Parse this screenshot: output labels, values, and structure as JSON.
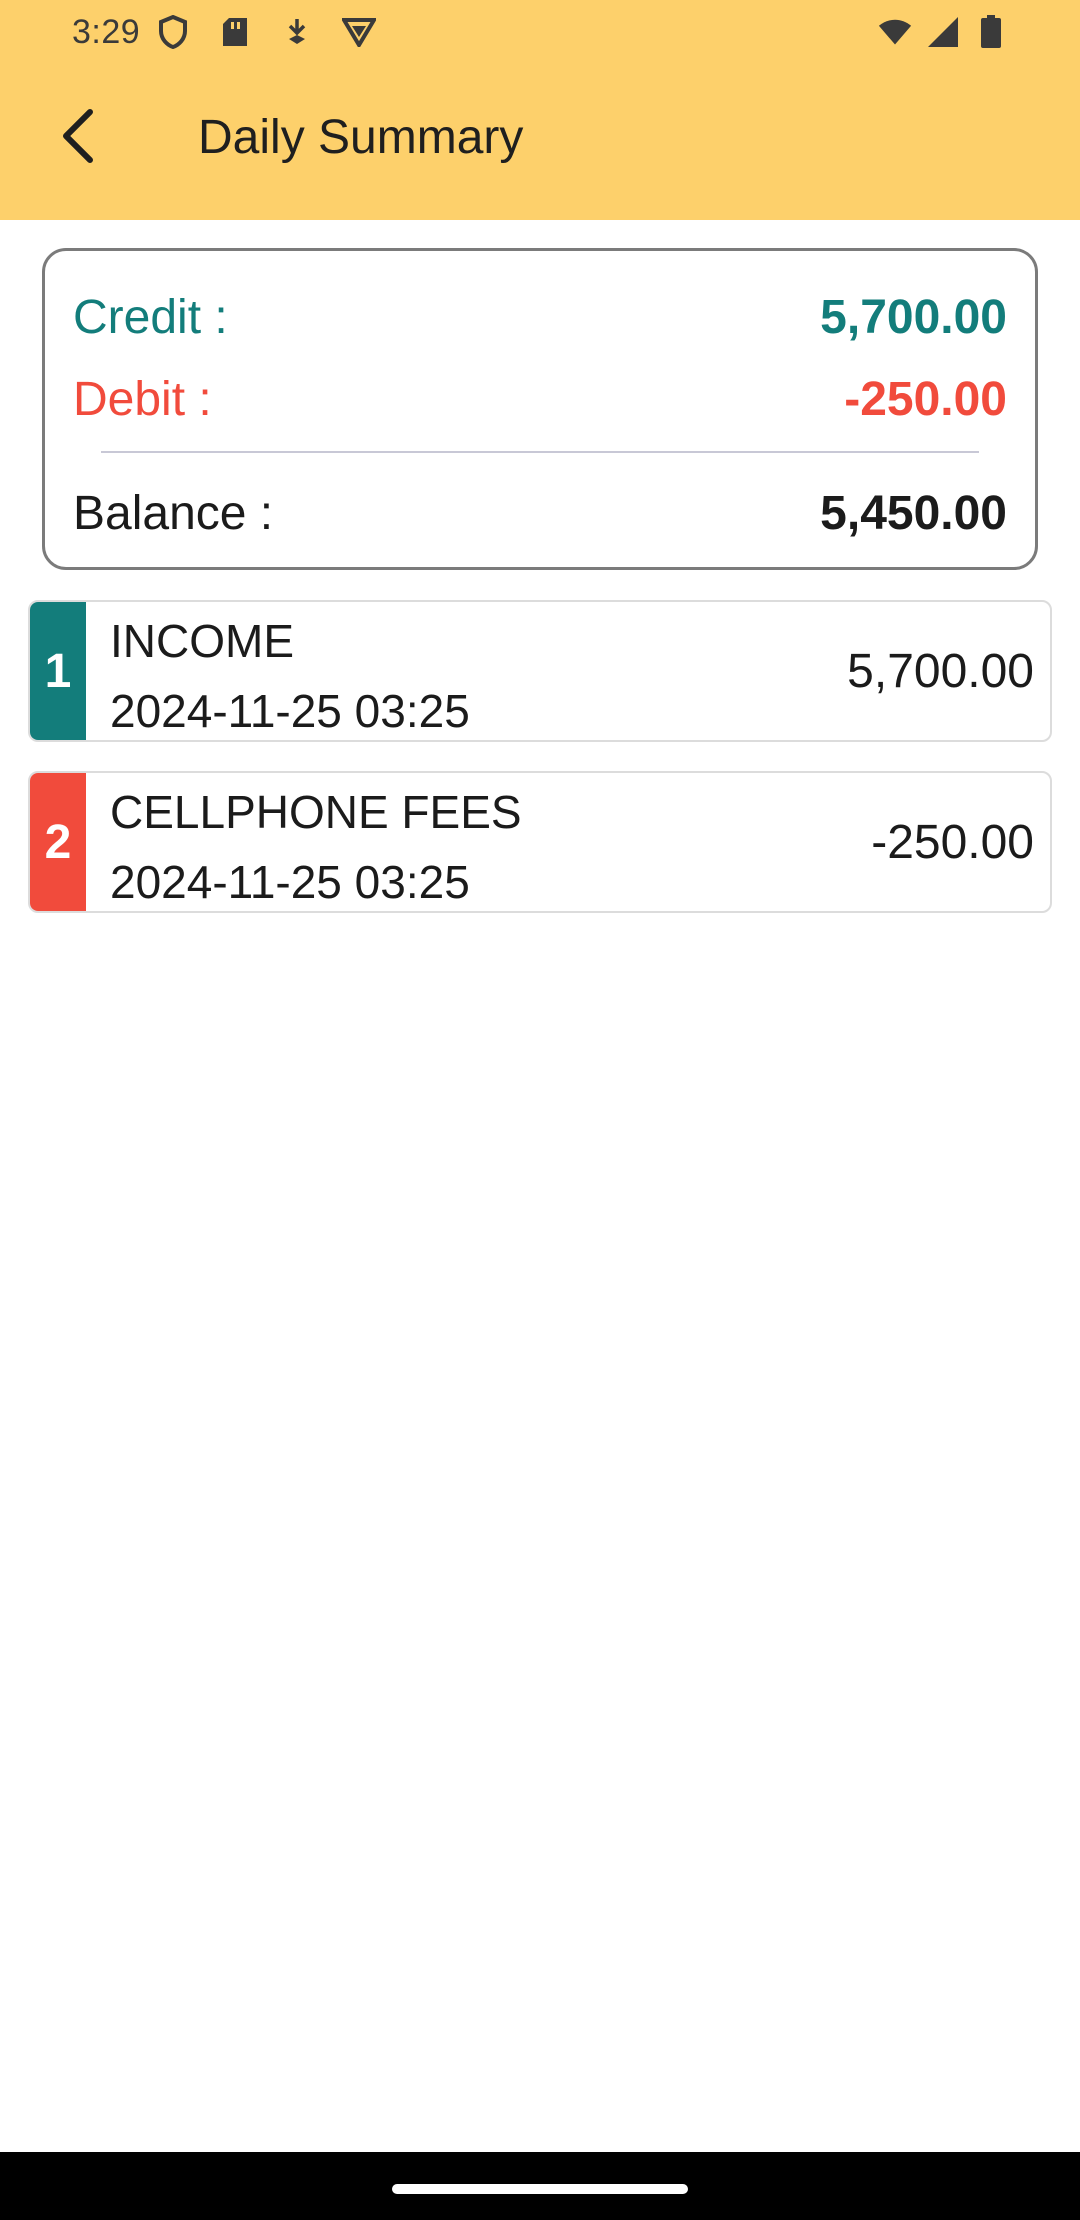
{
  "status_bar": {
    "time": "3:29",
    "left_icons": [
      "shield-icon",
      "sd-card-icon",
      "download-icon",
      "vpn-icon"
    ],
    "right_icons": [
      "wifi-icon",
      "signal-icon",
      "battery-icon"
    ]
  },
  "app_bar": {
    "title": "Daily Summary",
    "back_icon": "back-arrow-icon",
    "background": "#FDD06B"
  },
  "summary": {
    "credit_label": "Credit :",
    "credit_value": "5,700.00",
    "debit_label": "Debit :",
    "debit_value": "-250.00",
    "balance_label": "Balance :",
    "balance_value": "5,450.00",
    "credit_color": "#137D7B",
    "debit_color": "#F14B3C"
  },
  "transactions": [
    {
      "index": "1",
      "title": "INCOME",
      "datetime": "2024-11-25 03:25",
      "amount": "5,700.00",
      "color": "#137D7B"
    },
    {
      "index": "2",
      "title": "CELLPHONE FEES",
      "datetime": "2024-11-25 03:25",
      "amount": "-250.00",
      "color": "#F14B3C"
    }
  ]
}
